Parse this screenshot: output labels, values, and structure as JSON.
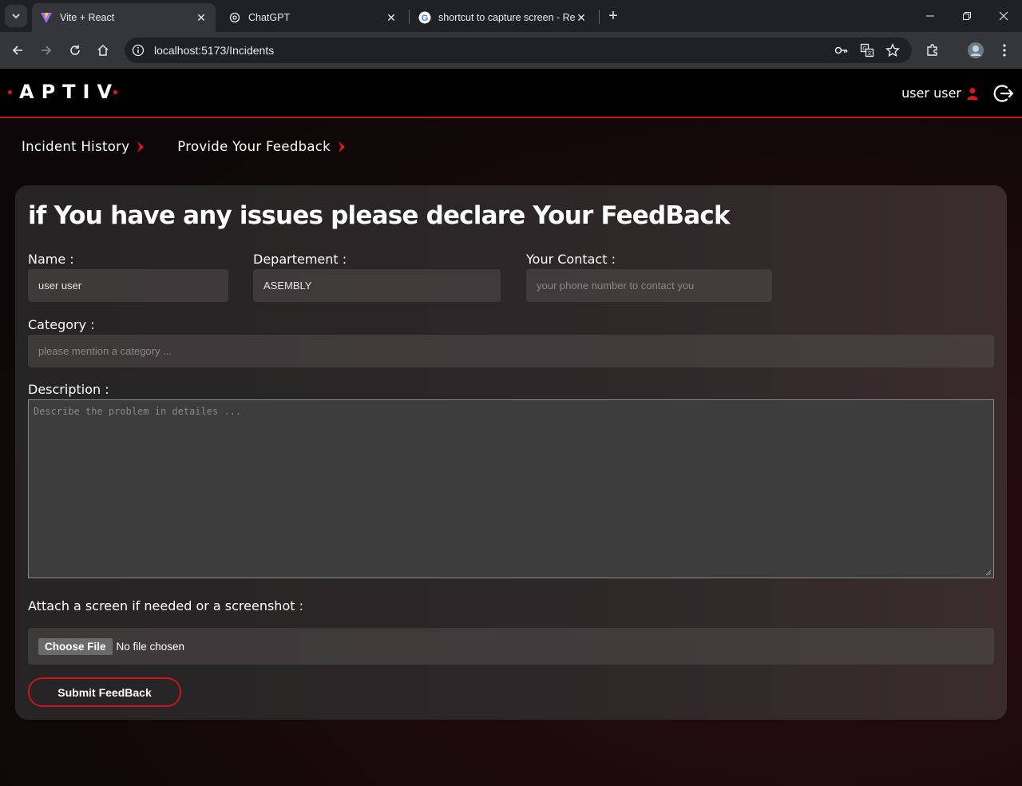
{
  "browser": {
    "tabs": [
      {
        "title": "Vite + React",
        "active": true
      },
      {
        "title": "ChatGPT",
        "active": false
      },
      {
        "title": "shortcut to capture screen - Re",
        "active": false
      }
    ],
    "url": "localhost:5173/Incidents"
  },
  "header": {
    "logo_text": "APTIV",
    "user_name": "user user"
  },
  "subnav": {
    "items": [
      {
        "label": "Incident History"
      },
      {
        "label": "Provide Your Feedback"
      }
    ]
  },
  "form": {
    "heading": "if You have any issues please declare Your FeedBack",
    "name_label": "Name :",
    "name_value": "user user",
    "department_label": "Departement :",
    "department_value": "ASEMBLY",
    "contact_label": "Your Contact :",
    "contact_placeholder": "your phone number to contact you",
    "category_label": "Category :",
    "category_placeholder": "please mention a category ...",
    "description_label": "Description :",
    "description_placeholder": "Describe the problem in detailes ...",
    "attach_label": "Attach a screen if needed or a screenshot :",
    "choose_file_label": "Choose File",
    "no_file_text": "No file chosen",
    "submit_label": "Submit FeedBack"
  },
  "colors": {
    "accent": "#c8161d",
    "header_bg": "#000000",
    "card_bg": "#2a2627"
  }
}
